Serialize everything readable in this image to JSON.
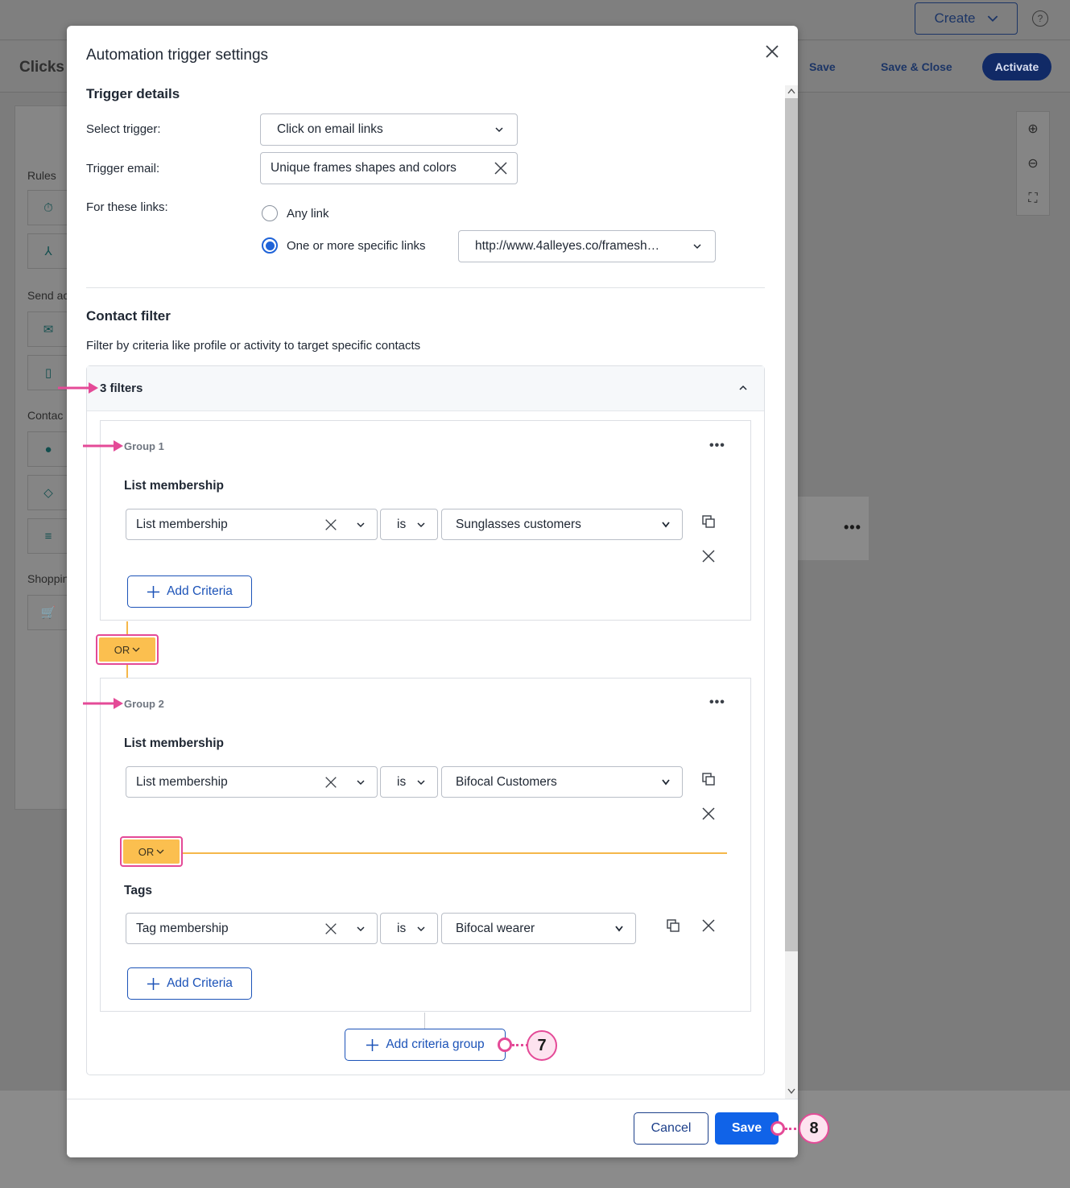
{
  "background": {
    "create_button": "Create",
    "help_icon": "?",
    "page_title": "Clicks t",
    "save": "Save",
    "save_close": "Save & Close",
    "activate": "Activate",
    "sections": {
      "rules": "Rules",
      "send": "Send ac",
      "contact": "Contac",
      "shopping": "Shoppin"
    }
  },
  "modal": {
    "title": "Automation trigger settings",
    "trigger_details": {
      "heading": "Trigger details",
      "select_trigger_label": "Select trigger:",
      "select_trigger_value": "Click on email links",
      "trigger_email_label": "Trigger email:",
      "trigger_email_value": "Unique frames shapes and colors",
      "links_label": "For these links:",
      "option_any": "Any link",
      "option_specific": "One or more specific links",
      "specific_link_value": "http://www.4alleyes.co/framesh…",
      "selected_option": "specific"
    },
    "contact_filter": {
      "heading": "Contact filter",
      "description": "Filter by criteria like profile or activity to target specific contacts",
      "filters_count": "3 filters",
      "groups": [
        {
          "label": "Group 1",
          "criteria_heading": "List membership",
          "field": "List membership",
          "operator": "is",
          "value": "Sunglasses customers",
          "add_criteria": "Add Criteria"
        },
        {
          "label": "Group 2",
          "criteria_heading": "List membership",
          "field": "List membership",
          "operator": "is",
          "value": "Bifocal Customers",
          "or_label": "OR",
          "criteria2_heading": "Tags",
          "field2": "Tag membership",
          "operator2": "is",
          "value2": "Bifocal wearer",
          "add_criteria": "Add Criteria"
        }
      ],
      "group_connector": "OR",
      "add_group": "Add criteria group"
    },
    "footer": {
      "cancel": "Cancel",
      "save": "Save"
    }
  },
  "callouts": {
    "step7": "7",
    "step8": "8"
  },
  "colors": {
    "accent": "#1063e8",
    "or_pill": "#fbbf4f",
    "annotation": "#e44a97"
  }
}
